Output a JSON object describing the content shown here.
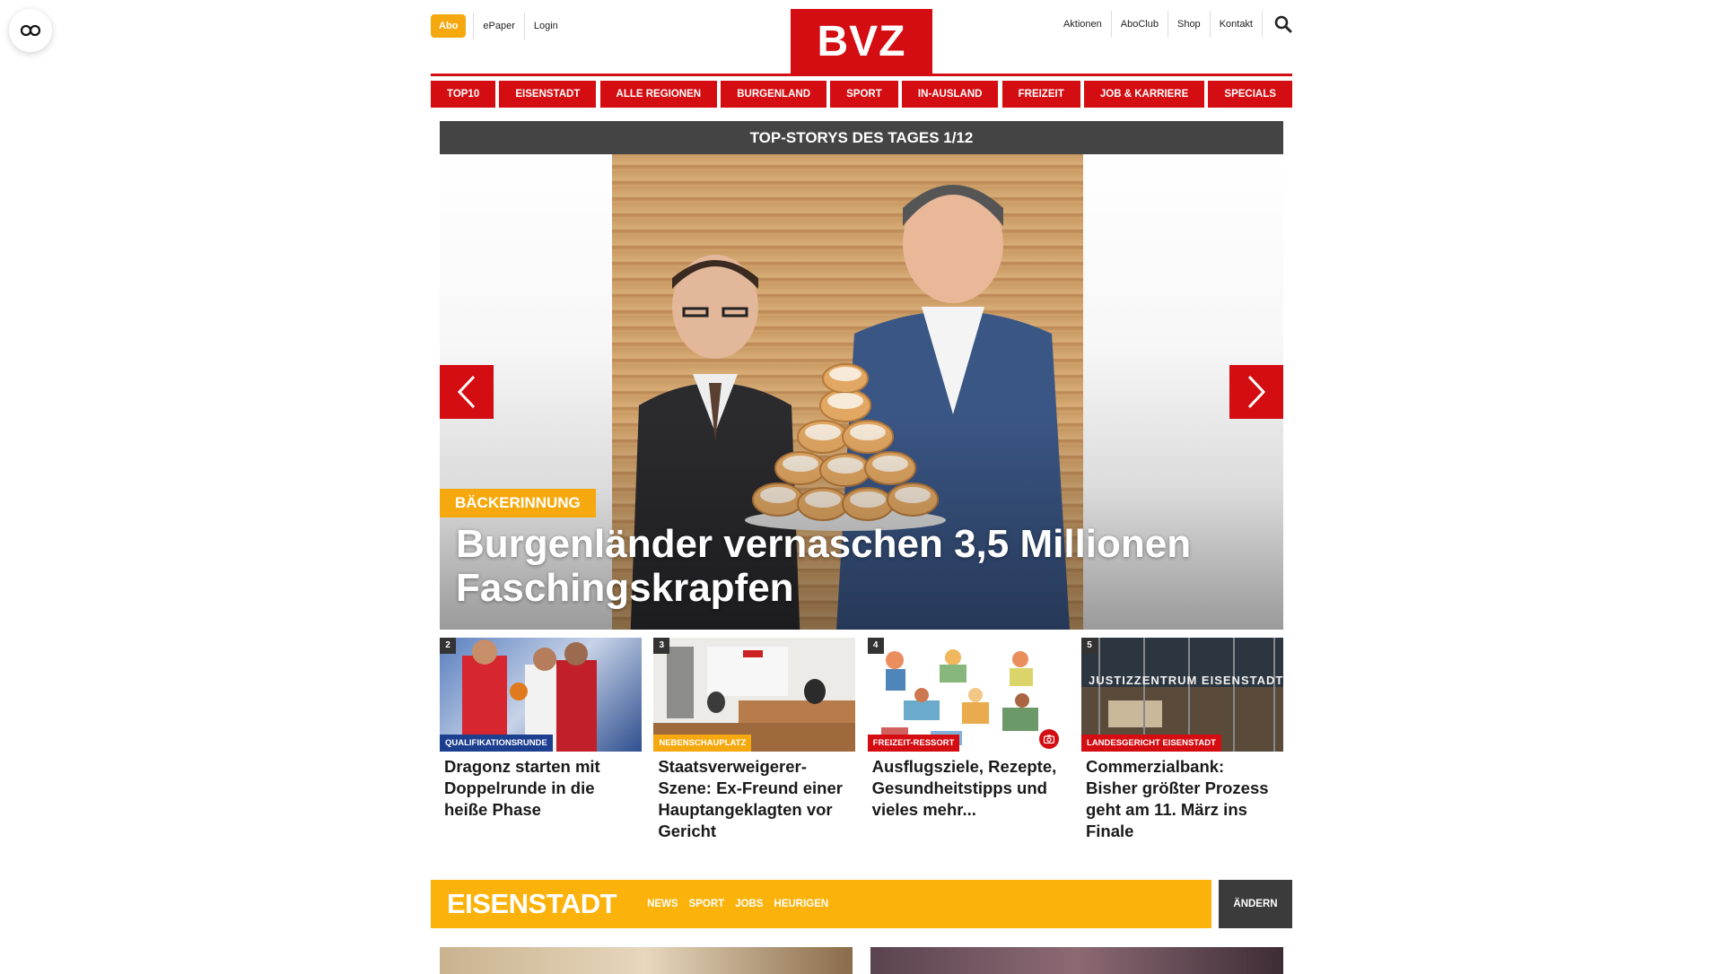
{
  "top": {
    "abo_label": "Abo",
    "left_links": [
      "ePaper",
      "Login"
    ],
    "logo_text": "BVZ",
    "right_links": [
      "Aktionen",
      "AboClub",
      "Shop",
      "Kontakt"
    ]
  },
  "nav": [
    "TOP10",
    "EISENSTADT",
    "ALLE REGIONEN",
    "BURGENLAND",
    "SPORT",
    "IN-AUSLAND",
    "FREIZEIT",
    "JOB & KARRIERE",
    "SPECIALS"
  ],
  "stories": {
    "header": "TOP-STORYS DES TAGES 1/12",
    "hero_tag": "BÄCKERINNUNG",
    "hero_title": "Burgenländer vernaschen 3,5 Millionen Faschingskrapfen"
  },
  "teasers": [
    {
      "num": "2",
      "tag": "QUALIFIKATIONSRUNDE",
      "tag_color": "#1d3f8f",
      "title": "Dragonz starten mit Doppelrunde in die heiße Phase"
    },
    {
      "num": "3",
      "tag": "NEBENSCHAUPLATZ",
      "tag_color": "#f5a90e",
      "title": "Staatsverweigerer-Szene: Ex-Freund einer Hauptangeklagten vor Gericht"
    },
    {
      "num": "4",
      "tag": "FREIZEIT-RESSORT",
      "tag_color": "#d40d12",
      "title": "Ausflugsziele, Rezepte, Gesundheitstipps und vieles mehr..."
    },
    {
      "num": "5",
      "tag": "LANDESGERICHT EISENSTADT",
      "tag_color": "#d40d12",
      "title": "Commerzialbank: Bisher größter Prozess geht am 11. März ins Finale"
    }
  ],
  "teaser4_sign": "JUSTIZZENTRUM EISENSTADT",
  "region": {
    "title": "EISENSTADT",
    "links": [
      "NEWS",
      "SPORT",
      "JOBS",
      "HEURIGEN"
    ],
    "change_label": "ÄNDERN"
  },
  "colors": {
    "brand_red": "#d40d12",
    "accent_yellow": "#f5a90e",
    "region_yellow": "#fbb20a",
    "dark": "#444444"
  }
}
